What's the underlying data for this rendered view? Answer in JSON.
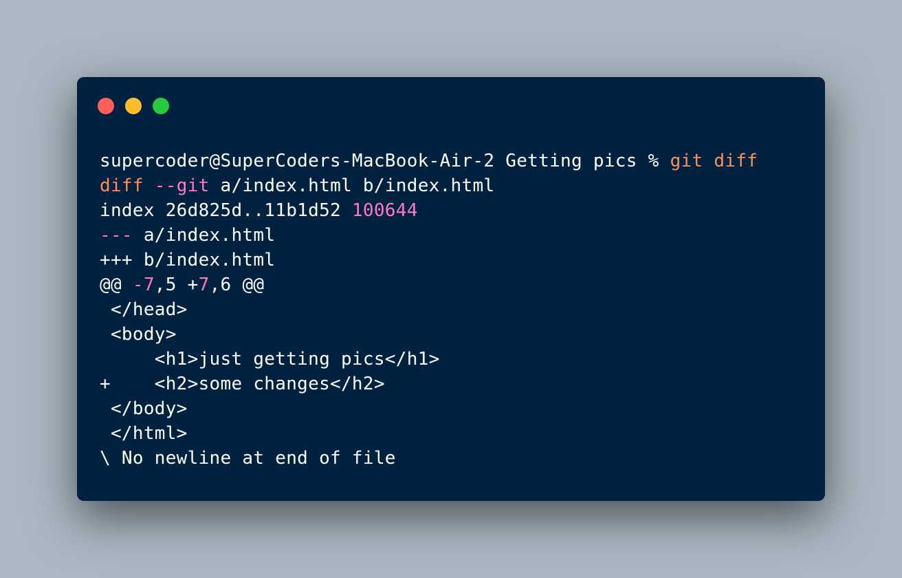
{
  "window": {
    "buttons": {
      "close": {
        "icon": "red-circle-icon",
        "color": "#ff5f56"
      },
      "minimize": {
        "icon": "yellow-circle-icon",
        "color": "#ffbd2e"
      },
      "zoom": {
        "icon": "green-circle-icon",
        "color": "#27c93f"
      }
    }
  },
  "terminal": {
    "prompt": "supercoder@SuperCoders-MacBook-Air-2 Getting pics % ",
    "command": "git diff",
    "diff_header": {
      "keyword": "diff",
      "space": " ",
      "flag": "--git",
      "files": " a/index.html b/index.html"
    },
    "index_line": {
      "text": "index 26d825d..11b1d52 ",
      "mode": "100644"
    },
    "old_file": {
      "marker": "---",
      "path": " a/index.html"
    },
    "new_file": "+++ b/index.html",
    "hunk": {
      "open": "@@ ",
      "old_start": "-7",
      "old_count": ",5 +",
      "new_start": "7",
      "new_count": ",6 @@"
    },
    "lines": [
      " </head>",
      " <body>",
      "     <h1>just getting pics</h1>",
      "+    <h2>some changes</h2>",
      " </body>",
      " </html>",
      "\\ No newline at end of file"
    ]
  }
}
